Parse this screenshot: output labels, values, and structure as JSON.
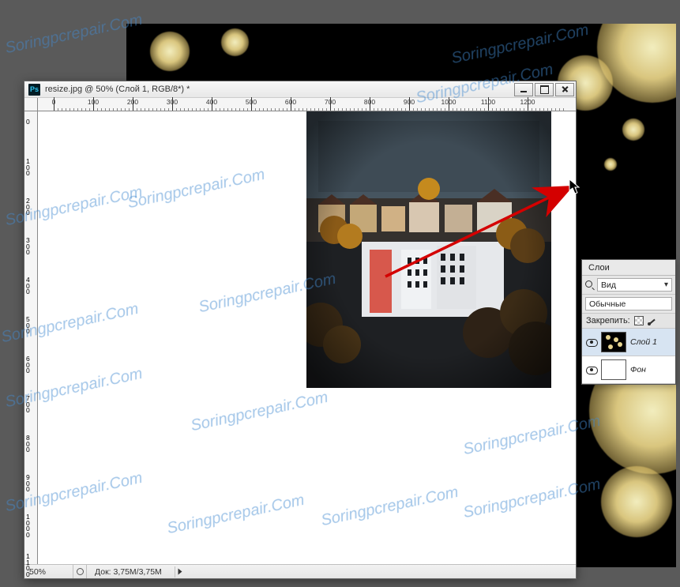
{
  "window": {
    "title": "resize.jpg @ 50% (Слой 1, RGB/8*) *"
  },
  "statusbar": {
    "zoom": "50%",
    "doc_info": "Док: 3,75M/3,75M"
  },
  "ruler_h_ticks": [
    "0",
    "100",
    "200",
    "300",
    "400",
    "500",
    "600",
    "700",
    "800",
    "900",
    "1000",
    "1100",
    "1200"
  ],
  "ruler_v_ticks": [
    "0",
    "100",
    "200",
    "300",
    "400",
    "500",
    "600",
    "700",
    "800",
    "900",
    "1000",
    "1100"
  ],
  "layers_panel": {
    "tab": "Слои",
    "search_type": "Вид",
    "blend_mode": "Обычные",
    "lock_label": "Закрепить:",
    "layers": [
      {
        "name": "Слой 1",
        "selected": true
      },
      {
        "name": "Фон",
        "selected": false
      }
    ]
  },
  "icons": {
    "ps": "Ps",
    "dropdown_chev": "▾"
  },
  "watermark_text": "Soringpcrepair.Com",
  "colors": {
    "arrow": "#D40000",
    "workspace": "#5a5a5a",
    "panel_bg": "#e4e4e4",
    "selected_layer": "#d7e4f2"
  }
}
